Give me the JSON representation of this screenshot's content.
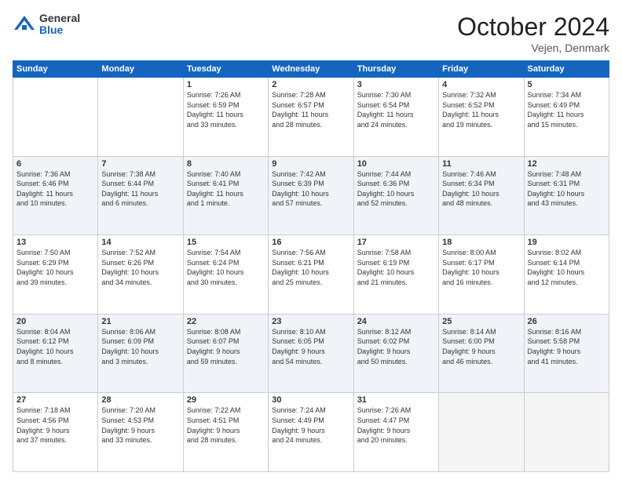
{
  "header": {
    "logo_general": "General",
    "logo_blue": "Blue",
    "month": "October 2024",
    "location": "Vejen, Denmark"
  },
  "weekdays": [
    "Sunday",
    "Monday",
    "Tuesday",
    "Wednesday",
    "Thursday",
    "Friday",
    "Saturday"
  ],
  "weeks": [
    [
      {
        "day": "",
        "info": ""
      },
      {
        "day": "",
        "info": ""
      },
      {
        "day": "1",
        "info": "Sunrise: 7:26 AM\nSunset: 6:59 PM\nDaylight: 11 hours\nand 33 minutes."
      },
      {
        "day": "2",
        "info": "Sunrise: 7:28 AM\nSunset: 6:57 PM\nDaylight: 11 hours\nand 28 minutes."
      },
      {
        "day": "3",
        "info": "Sunrise: 7:30 AM\nSunset: 6:54 PM\nDaylight: 11 hours\nand 24 minutes."
      },
      {
        "day": "4",
        "info": "Sunrise: 7:32 AM\nSunset: 6:52 PM\nDaylight: 11 hours\nand 19 minutes."
      },
      {
        "day": "5",
        "info": "Sunrise: 7:34 AM\nSunset: 6:49 PM\nDaylight: 11 hours\nand 15 minutes."
      }
    ],
    [
      {
        "day": "6",
        "info": "Sunrise: 7:36 AM\nSunset: 6:46 PM\nDaylight: 11 hours\nand 10 minutes."
      },
      {
        "day": "7",
        "info": "Sunrise: 7:38 AM\nSunset: 6:44 PM\nDaylight: 11 hours\nand 6 minutes."
      },
      {
        "day": "8",
        "info": "Sunrise: 7:40 AM\nSunset: 6:41 PM\nDaylight: 11 hours\nand 1 minute."
      },
      {
        "day": "9",
        "info": "Sunrise: 7:42 AM\nSunset: 6:39 PM\nDaylight: 10 hours\nand 57 minutes."
      },
      {
        "day": "10",
        "info": "Sunrise: 7:44 AM\nSunset: 6:36 PM\nDaylight: 10 hours\nand 52 minutes."
      },
      {
        "day": "11",
        "info": "Sunrise: 7:46 AM\nSunset: 6:34 PM\nDaylight: 10 hours\nand 48 minutes."
      },
      {
        "day": "12",
        "info": "Sunrise: 7:48 AM\nSunset: 6:31 PM\nDaylight: 10 hours\nand 43 minutes."
      }
    ],
    [
      {
        "day": "13",
        "info": "Sunrise: 7:50 AM\nSunset: 6:29 PM\nDaylight: 10 hours\nand 39 minutes."
      },
      {
        "day": "14",
        "info": "Sunrise: 7:52 AM\nSunset: 6:26 PM\nDaylight: 10 hours\nand 34 minutes."
      },
      {
        "day": "15",
        "info": "Sunrise: 7:54 AM\nSunset: 6:24 PM\nDaylight: 10 hours\nand 30 minutes."
      },
      {
        "day": "16",
        "info": "Sunrise: 7:56 AM\nSunset: 6:21 PM\nDaylight: 10 hours\nand 25 minutes."
      },
      {
        "day": "17",
        "info": "Sunrise: 7:58 AM\nSunset: 6:19 PM\nDaylight: 10 hours\nand 21 minutes."
      },
      {
        "day": "18",
        "info": "Sunrise: 8:00 AM\nSunset: 6:17 PM\nDaylight: 10 hours\nand 16 minutes."
      },
      {
        "day": "19",
        "info": "Sunrise: 8:02 AM\nSunset: 6:14 PM\nDaylight: 10 hours\nand 12 minutes."
      }
    ],
    [
      {
        "day": "20",
        "info": "Sunrise: 8:04 AM\nSunset: 6:12 PM\nDaylight: 10 hours\nand 8 minutes."
      },
      {
        "day": "21",
        "info": "Sunrise: 8:06 AM\nSunset: 6:09 PM\nDaylight: 10 hours\nand 3 minutes."
      },
      {
        "day": "22",
        "info": "Sunrise: 8:08 AM\nSunset: 6:07 PM\nDaylight: 9 hours\nand 59 minutes."
      },
      {
        "day": "23",
        "info": "Sunrise: 8:10 AM\nSunset: 6:05 PM\nDaylight: 9 hours\nand 54 minutes."
      },
      {
        "day": "24",
        "info": "Sunrise: 8:12 AM\nSunset: 6:02 PM\nDaylight: 9 hours\nand 50 minutes."
      },
      {
        "day": "25",
        "info": "Sunrise: 8:14 AM\nSunset: 6:00 PM\nDaylight: 9 hours\nand 46 minutes."
      },
      {
        "day": "26",
        "info": "Sunrise: 8:16 AM\nSunset: 5:58 PM\nDaylight: 9 hours\nand 41 minutes."
      }
    ],
    [
      {
        "day": "27",
        "info": "Sunrise: 7:18 AM\nSunset: 4:56 PM\nDaylight: 9 hours\nand 37 minutes."
      },
      {
        "day": "28",
        "info": "Sunrise: 7:20 AM\nSunset: 4:53 PM\nDaylight: 9 hours\nand 33 minutes."
      },
      {
        "day": "29",
        "info": "Sunrise: 7:22 AM\nSunset: 4:51 PM\nDaylight: 9 hours\nand 28 minutes."
      },
      {
        "day": "30",
        "info": "Sunrise: 7:24 AM\nSunset: 4:49 PM\nDaylight: 9 hours\nand 24 minutes."
      },
      {
        "day": "31",
        "info": "Sunrise: 7:26 AM\nSunset: 4:47 PM\nDaylight: 9 hours\nand 20 minutes."
      },
      {
        "day": "",
        "info": ""
      },
      {
        "day": "",
        "info": ""
      }
    ]
  ]
}
